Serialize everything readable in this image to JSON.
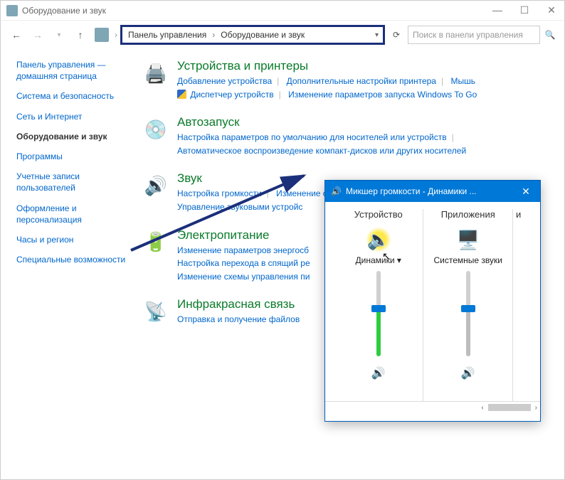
{
  "window": {
    "title": "Оборудование и звук"
  },
  "breadcrumb": {
    "crumb1": "Панель управления",
    "crumb2": "Оборудование и звук"
  },
  "search": {
    "placeholder": "Поиск в панели управления"
  },
  "sidebar": {
    "home1": "Панель управления —",
    "home2": "домашняя страница",
    "items": [
      {
        "label": "Система и безопасность"
      },
      {
        "label": "Сеть и Интернет"
      },
      {
        "label": "Оборудование и звук",
        "active": true
      },
      {
        "label": "Программы"
      },
      {
        "label": "Учетные записи пользователей"
      },
      {
        "label": "Оформление и персонализация"
      },
      {
        "label": "Часы и регион"
      },
      {
        "label": "Специальные возможности"
      }
    ]
  },
  "categories": {
    "devices": {
      "title": "Устройства и принтеры",
      "l1": "Добавление устройства",
      "l2": "Дополнительные настройки принтера",
      "l3": "Мышь",
      "l4": "Диспетчер устройств",
      "l5": "Изменение параметров запуска Windows To Go"
    },
    "autoplay": {
      "title": "Автозапуск",
      "l1": "Настройка параметров по умолчанию для носителей или устройств",
      "l2": "Автоматическое воспроизведение компакт-дисков или других носителей"
    },
    "sound": {
      "title": "Звук",
      "l1": "Настройка громкости",
      "l2": "Изменение системных звуков",
      "l3": "Управление звуковыми устройс"
    },
    "power": {
      "title": "Электропитание",
      "l1": "Изменение параметров энергосб",
      "l2": "Настройка перехода в спящий ре",
      "l3": "Изменение схемы управления пи"
    },
    "ir": {
      "title": "Инфракрасная связь",
      "l1": "Отправка и получение файлов"
    }
  },
  "mixer": {
    "title": "Микшер громкости - Динамики ...",
    "device_header": "Устройство",
    "apps_header": "Приложения",
    "speaker_label": "Динамики",
    "system_label": "Системные звуки",
    "extra_label": "и"
  }
}
